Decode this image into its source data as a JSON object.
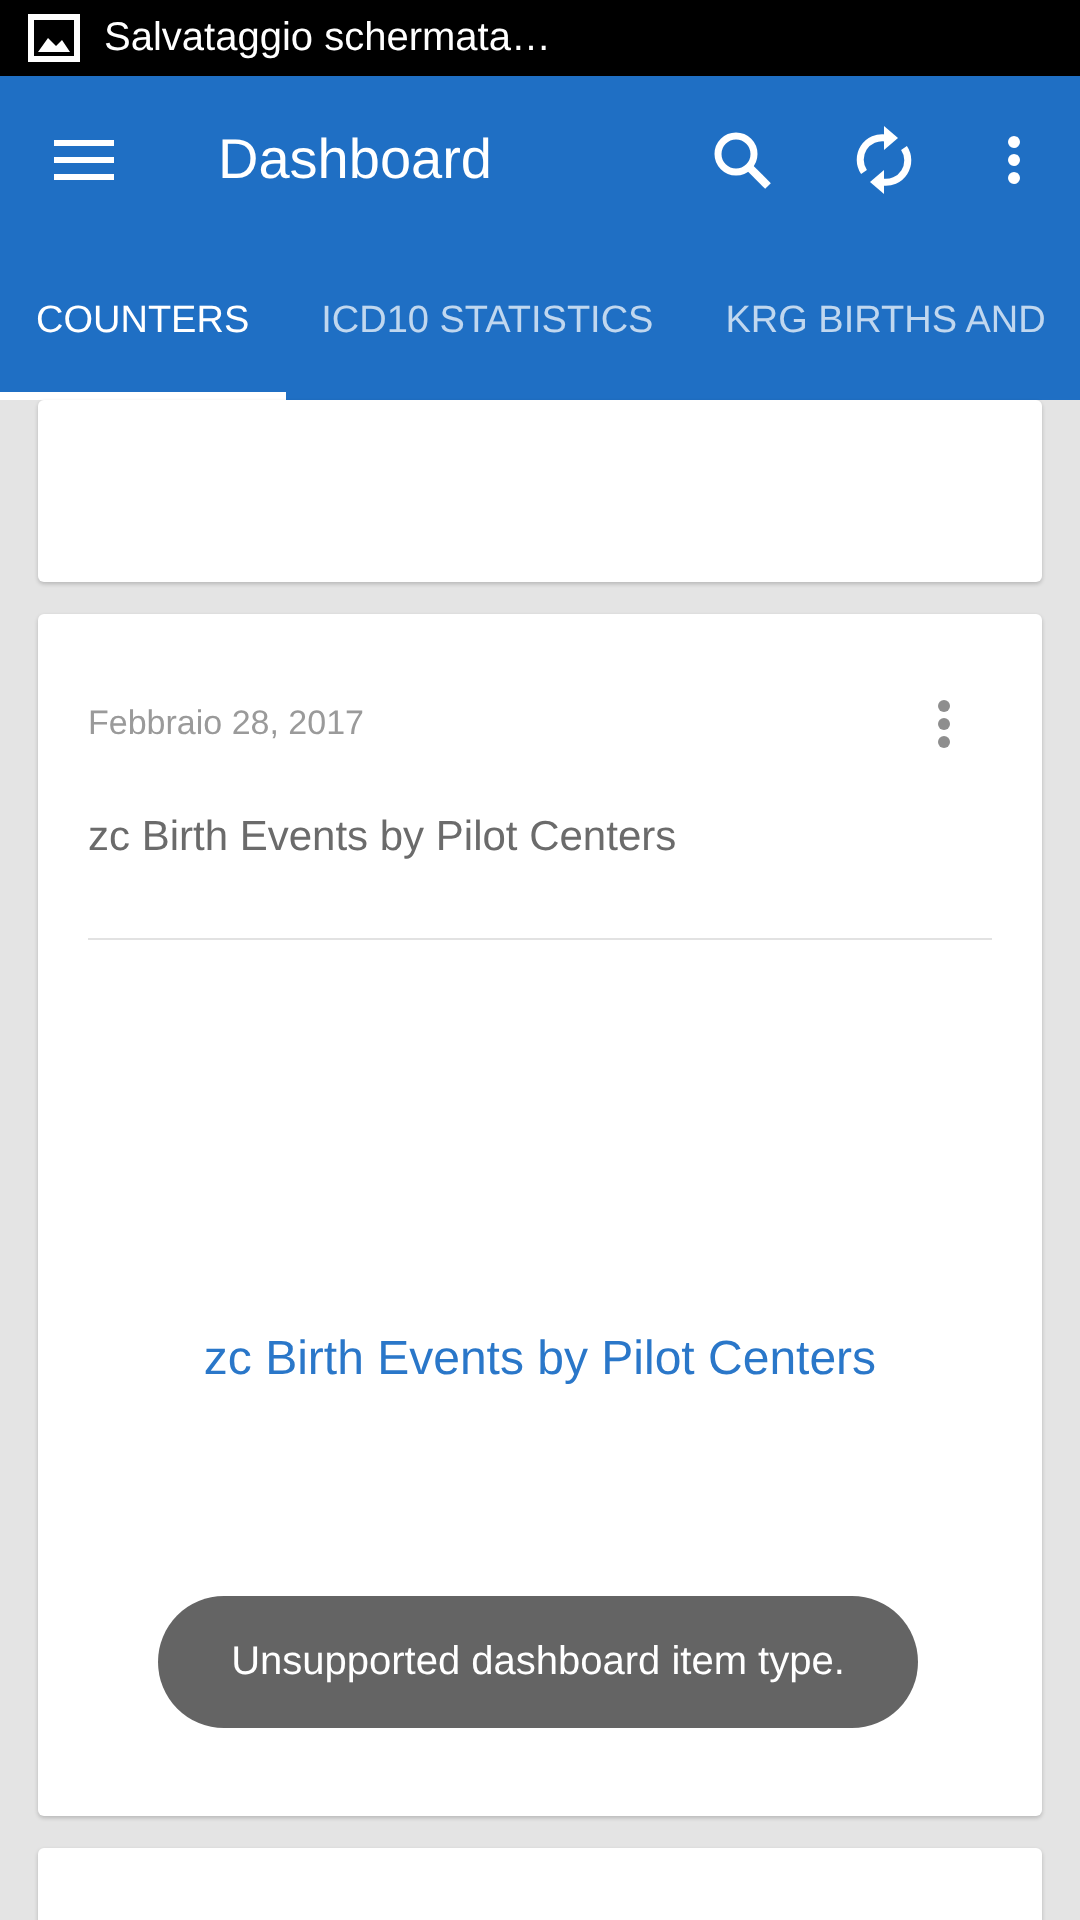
{
  "status_bar": {
    "notification": "Salvataggio schermata…"
  },
  "toolbar": {
    "title": "Dashboard"
  },
  "tabs": [
    {
      "label": "COUNTERS",
      "selected": true
    },
    {
      "label": "ICD10 STATISTICS",
      "selected": false
    },
    {
      "label": "KRG BIRTHS AND",
      "selected": false
    }
  ],
  "cards": [
    {
      "kind": "partial"
    },
    {
      "kind": "item",
      "date": "Febbraio 28, 2017",
      "title": "zc Birth Events by Pilot Centers",
      "link": "zc Birth Events by Pilot Centers",
      "toast": "Unsupported dashboard item type."
    },
    {
      "kind": "partial"
    }
  ]
}
